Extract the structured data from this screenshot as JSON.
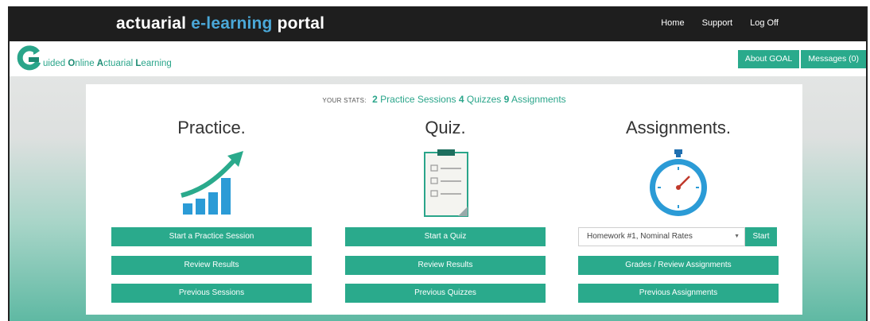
{
  "header": {
    "brand_part1": "actuarial ",
    "brand_part2": "e-learning",
    "brand_part3": " portal",
    "nav": [
      {
        "label": "Home"
      },
      {
        "label": "Support"
      },
      {
        "label": "Log Off"
      }
    ]
  },
  "logo": {
    "letter": "G",
    "text_parts": [
      "uided ",
      "O",
      "nline ",
      "A",
      "ctuarial ",
      "L",
      "earning"
    ]
  },
  "right_buttons": {
    "about": "About GOAL",
    "messages": "Messages (0)"
  },
  "stats": {
    "label": "YOUR STATS:",
    "practice_count": "2",
    "practice_label": "Practice Sessions",
    "quiz_count": "4",
    "quiz_label": "Quizzes",
    "assign_count": "9",
    "assign_label": "Assignments"
  },
  "practice": {
    "title": "Practice.",
    "buttons": [
      "Start a Practice Session",
      "Review Results",
      "Previous Sessions"
    ]
  },
  "quiz": {
    "title": "Quiz.",
    "buttons": [
      "Start a Quiz",
      "Review Results",
      "Previous Quizzes"
    ]
  },
  "assignments": {
    "title": "Assignments.",
    "select_value": "Homework #1, Nominal Rates",
    "start_label": "Start",
    "buttons": [
      "Grades / Review Assignments",
      "Previous Assignments"
    ]
  },
  "colors": {
    "accent": "#2aaa8c",
    "topbar": "#1e1e1e",
    "highlight": "#4aa8d8"
  },
  "icons": {
    "practice": "bar-chart-growth-icon",
    "quiz": "clipboard-icon",
    "assignments": "stopwatch-icon"
  }
}
